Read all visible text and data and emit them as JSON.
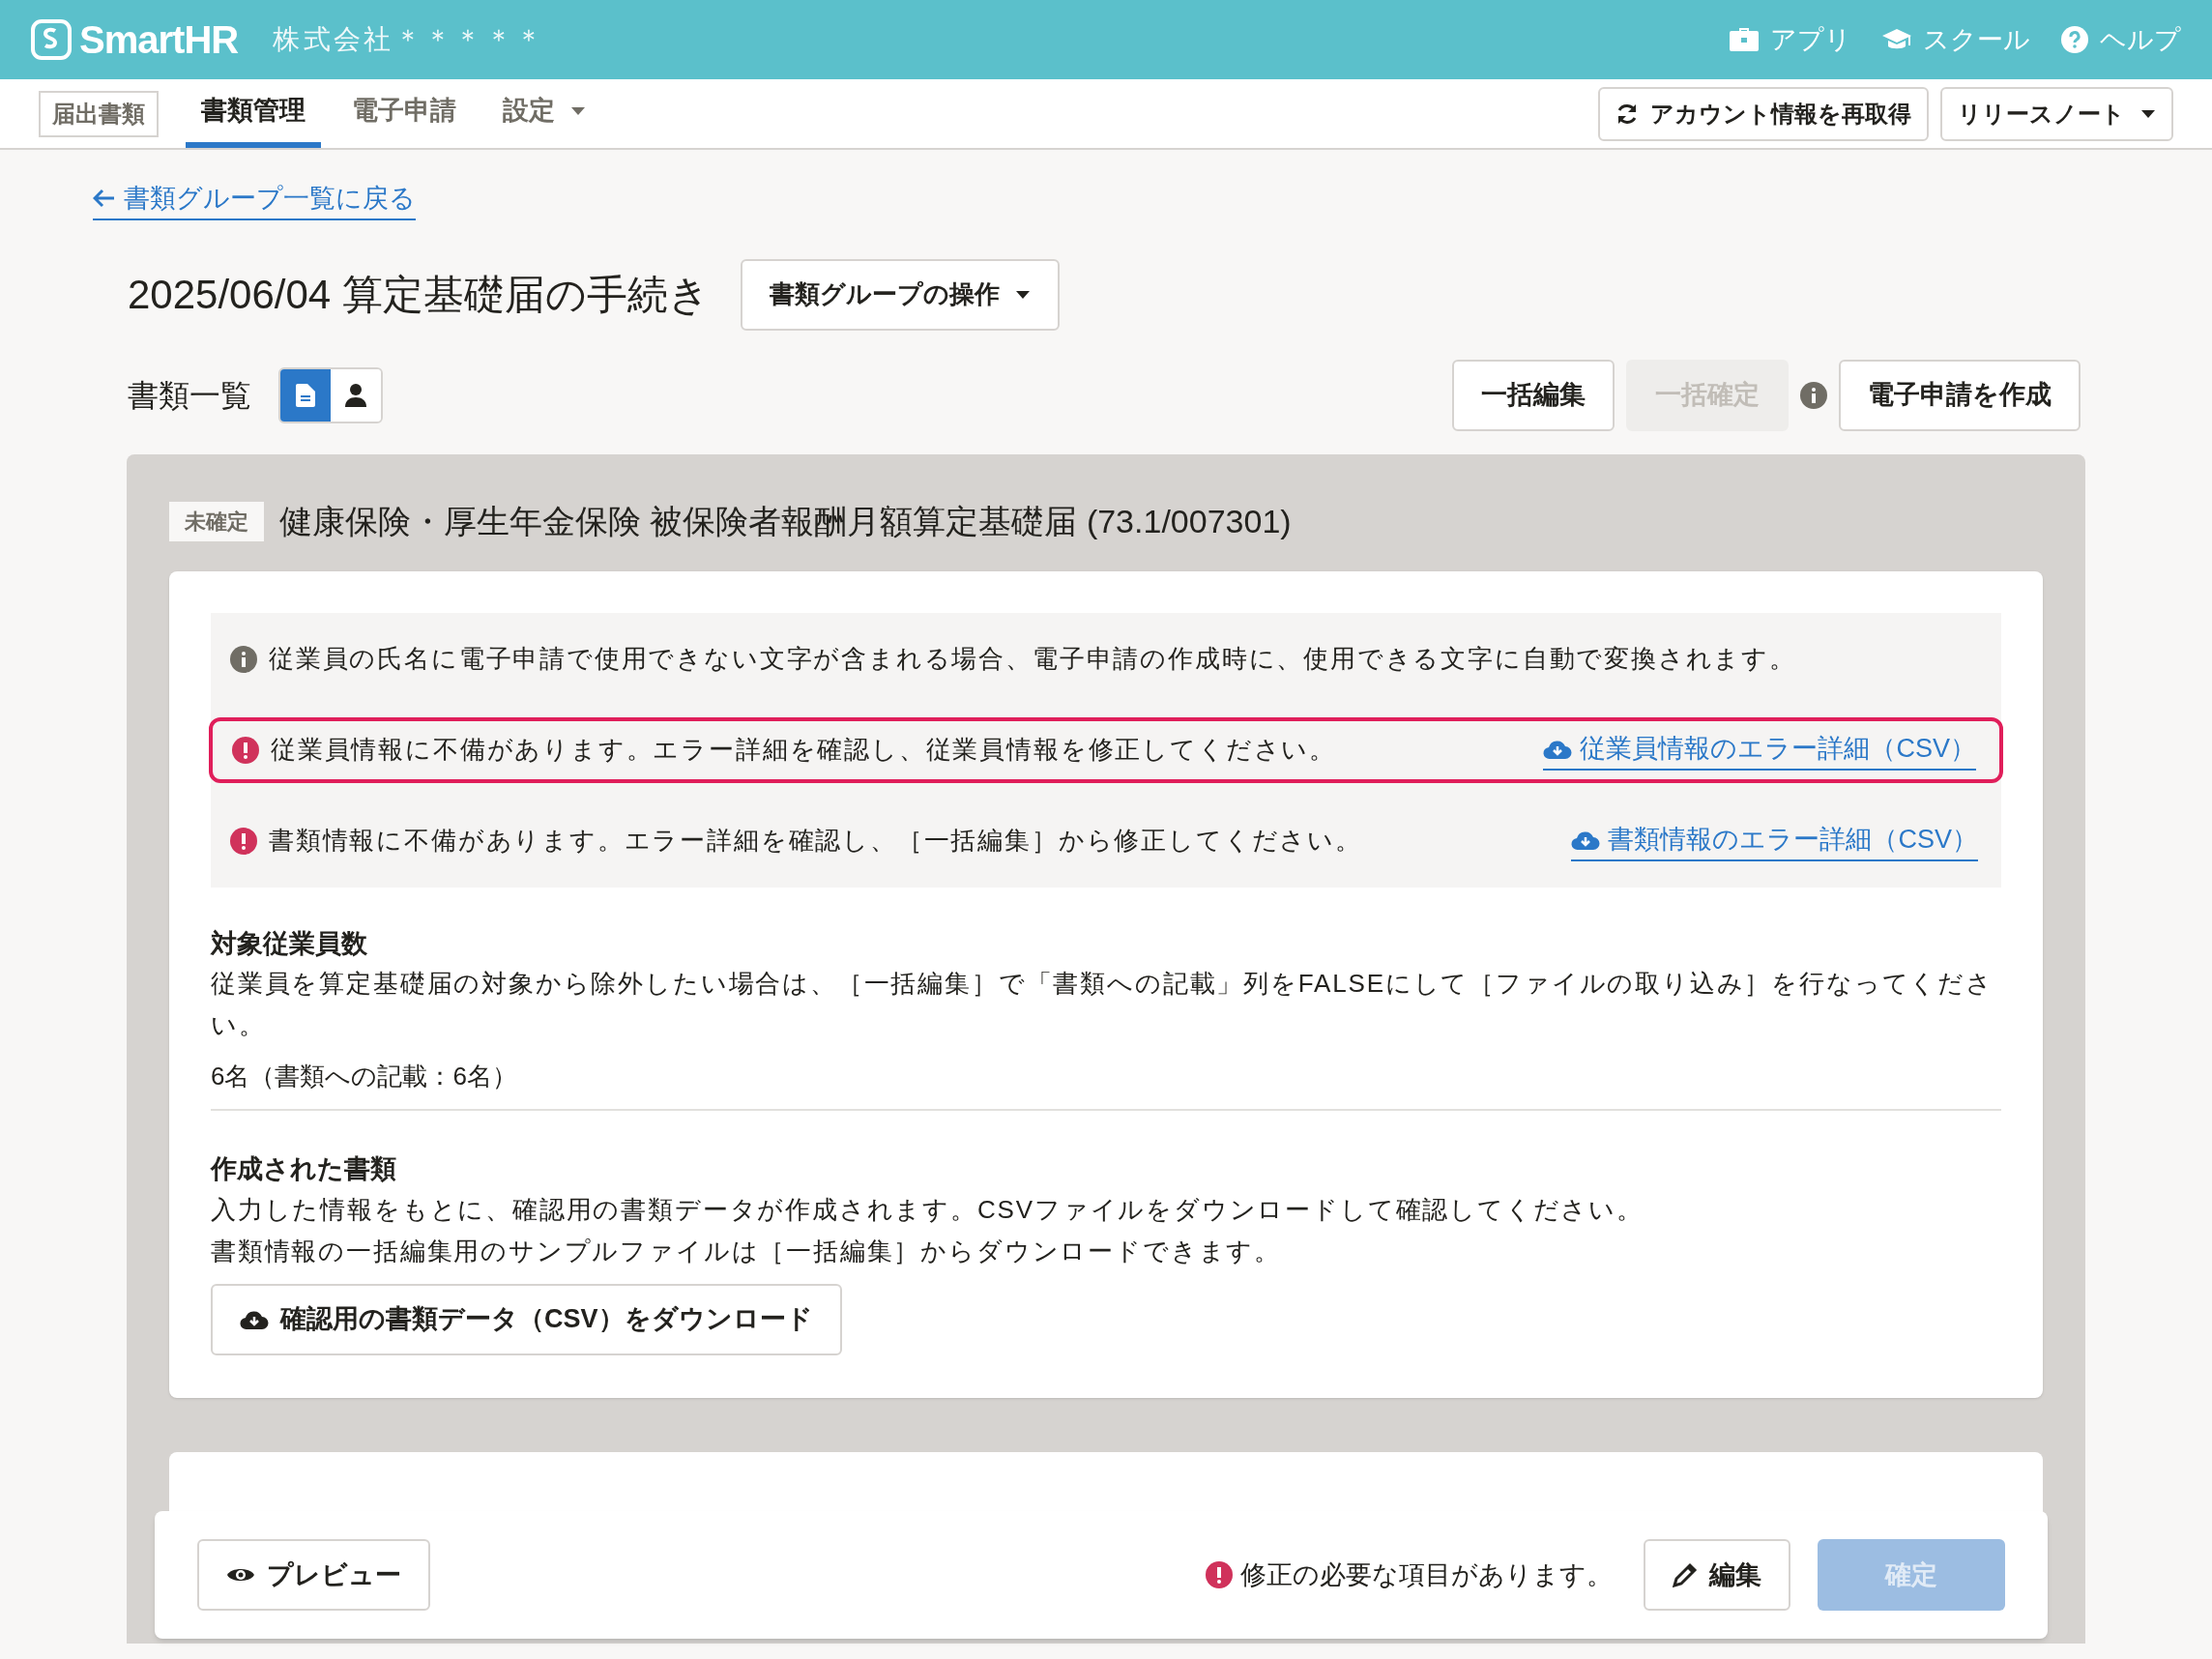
{
  "header": {
    "logo": "SmartHR",
    "company": "株式会社＊＊＊＊＊",
    "links": [
      {
        "label": "アプリ",
        "kind": "app"
      },
      {
        "label": "スクール",
        "kind": "school"
      },
      {
        "label": "ヘルプ",
        "kind": "help"
      }
    ]
  },
  "nav": {
    "app_label": "届出書類",
    "tabs": [
      {
        "label": "書類管理",
        "selected": true,
        "dropdown": false
      },
      {
        "label": "電子申請",
        "selected": false,
        "dropdown": false
      },
      {
        "label": "設定",
        "selected": false,
        "dropdown": true
      }
    ],
    "buttons": [
      {
        "label": "アカウント情報を再取得",
        "kind": "refresh"
      },
      {
        "label": "リリースノート",
        "kind": "dropdown"
      }
    ]
  },
  "back_link": "書類グループ一覧に戻る",
  "title": "2025/06/04 算定基礎届の手続き",
  "group_menu": "書類グループの操作",
  "list_label": "書類一覧",
  "view_toggle": [
    {
      "kind": "document",
      "selected": true
    },
    {
      "kind": "person",
      "selected": false
    }
  ],
  "actions": [
    {
      "label": "一括編集",
      "disabled": false,
      "info": false
    },
    {
      "label": "一括確定",
      "disabled": true,
      "info": true
    },
    {
      "label": "電子申請を作成",
      "disabled": false,
      "info": false
    }
  ],
  "document": {
    "status": "未確定",
    "title": "健康保険・厚生年金保険 被保険者報酬月額算定基礎届 (73.1/007301)",
    "notices": [
      {
        "kind": "info",
        "text": "従業員の氏名に電子申請で使用できない文字が含まれる場合、電子申請の作成時に、使用できる文字に自動で変換されます。",
        "highlighted": false
      },
      {
        "kind": "error",
        "text": "従業員情報に不備があります。エラー詳細を確認し、従業員情報を修正してください。",
        "link": "従業員情報のエラー詳細（CSV）",
        "highlighted": true
      },
      {
        "kind": "error",
        "text": "書類情報に不備があります。エラー詳細を確認し、［一括編集］から修正してください。",
        "link": "書類情報のエラー詳細（CSV）",
        "highlighted": false
      }
    ],
    "sections": [
      {
        "heading": "対象従業員数",
        "paragraphs": [
          "従業員を算定基礎届の対象から除外したい場合は、［一括編集］で「書類への記載」列をFALSEにして［ファイルの取り込み］を行なってください。"
        ],
        "value": "6名（書類への記載：6名）"
      },
      {
        "heading": "作成された書類",
        "paragraphs": [
          "入力した情報をもとに、確認用の書類データが作成されます。CSVファイルをダウンロードして確認してください。",
          "書類情報の一括編集用のサンプルファイルは［一括編集］からダウンロードできます。"
        ],
        "download_button": "確認用の書類データ（CSV）をダウンロード"
      }
    ]
  },
  "footer": {
    "preview": "プレビュー",
    "warning": "修正の必要な項目があります。",
    "edit": "編集",
    "confirm": {
      "label": "確定",
      "disabled": true
    }
  }
}
